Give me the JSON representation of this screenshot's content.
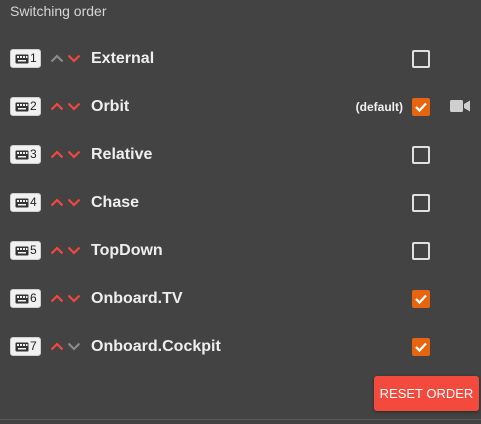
{
  "panel": {
    "title": "Switching order"
  },
  "colors": {
    "accent": "#e8650f",
    "arrow_active": "#f0483e",
    "arrow_disabled": "#8a8a8a",
    "reset": "#f4493d"
  },
  "rows": [
    {
      "key": "1",
      "label": "External",
      "checked": false,
      "up_enabled": false,
      "down_enabled": true
    },
    {
      "key": "2",
      "label": "Orbit",
      "checked": true,
      "default_text": "(default)",
      "camera_icon": true,
      "up_enabled": true,
      "down_enabled": true
    },
    {
      "key": "3",
      "label": "Relative",
      "checked": false,
      "up_enabled": true,
      "down_enabled": true
    },
    {
      "key": "4",
      "label": "Chase",
      "checked": false,
      "up_enabled": true,
      "down_enabled": true
    },
    {
      "key": "5",
      "label": "TopDown",
      "checked": false,
      "up_enabled": true,
      "down_enabled": true
    },
    {
      "key": "6",
      "label": "Onboard.TV",
      "checked": true,
      "up_enabled": true,
      "down_enabled": true
    },
    {
      "key": "7",
      "label": "Onboard.Cockpit",
      "checked": true,
      "up_enabled": true,
      "down_enabled": false
    }
  ],
  "reset_button": {
    "label": "RESET ORDER"
  }
}
